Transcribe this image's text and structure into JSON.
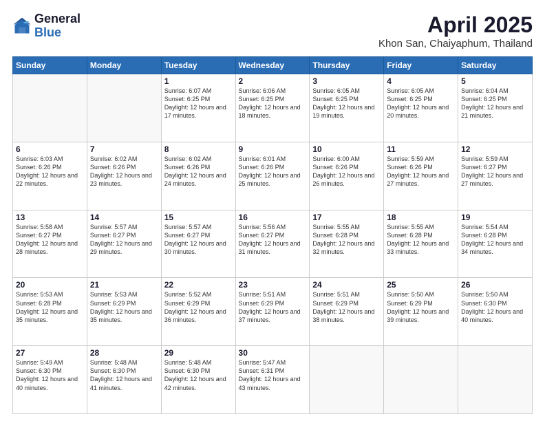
{
  "header": {
    "logo_general": "General",
    "logo_blue": "Blue",
    "title": "April 2025",
    "subtitle": "Khon San, Chaiyaphum, Thailand"
  },
  "weekdays": [
    "Sunday",
    "Monday",
    "Tuesday",
    "Wednesday",
    "Thursday",
    "Friday",
    "Saturday"
  ],
  "weeks": [
    [
      {
        "day": "",
        "info": ""
      },
      {
        "day": "",
        "info": ""
      },
      {
        "day": "1",
        "info": "Sunrise: 6:07 AM\nSunset: 6:25 PM\nDaylight: 12 hours and 17 minutes."
      },
      {
        "day": "2",
        "info": "Sunrise: 6:06 AM\nSunset: 6:25 PM\nDaylight: 12 hours and 18 minutes."
      },
      {
        "day": "3",
        "info": "Sunrise: 6:05 AM\nSunset: 6:25 PM\nDaylight: 12 hours and 19 minutes."
      },
      {
        "day": "4",
        "info": "Sunrise: 6:05 AM\nSunset: 6:25 PM\nDaylight: 12 hours and 20 minutes."
      },
      {
        "day": "5",
        "info": "Sunrise: 6:04 AM\nSunset: 6:25 PM\nDaylight: 12 hours and 21 minutes."
      }
    ],
    [
      {
        "day": "6",
        "info": "Sunrise: 6:03 AM\nSunset: 6:26 PM\nDaylight: 12 hours and 22 minutes."
      },
      {
        "day": "7",
        "info": "Sunrise: 6:02 AM\nSunset: 6:26 PM\nDaylight: 12 hours and 23 minutes."
      },
      {
        "day": "8",
        "info": "Sunrise: 6:02 AM\nSunset: 6:26 PM\nDaylight: 12 hours and 24 minutes."
      },
      {
        "day": "9",
        "info": "Sunrise: 6:01 AM\nSunset: 6:26 PM\nDaylight: 12 hours and 25 minutes."
      },
      {
        "day": "10",
        "info": "Sunrise: 6:00 AM\nSunset: 6:26 PM\nDaylight: 12 hours and 26 minutes."
      },
      {
        "day": "11",
        "info": "Sunrise: 5:59 AM\nSunset: 6:26 PM\nDaylight: 12 hours and 27 minutes."
      },
      {
        "day": "12",
        "info": "Sunrise: 5:59 AM\nSunset: 6:27 PM\nDaylight: 12 hours and 27 minutes."
      }
    ],
    [
      {
        "day": "13",
        "info": "Sunrise: 5:58 AM\nSunset: 6:27 PM\nDaylight: 12 hours and 28 minutes."
      },
      {
        "day": "14",
        "info": "Sunrise: 5:57 AM\nSunset: 6:27 PM\nDaylight: 12 hours and 29 minutes."
      },
      {
        "day": "15",
        "info": "Sunrise: 5:57 AM\nSunset: 6:27 PM\nDaylight: 12 hours and 30 minutes."
      },
      {
        "day": "16",
        "info": "Sunrise: 5:56 AM\nSunset: 6:27 PM\nDaylight: 12 hours and 31 minutes."
      },
      {
        "day": "17",
        "info": "Sunrise: 5:55 AM\nSunset: 6:28 PM\nDaylight: 12 hours and 32 minutes."
      },
      {
        "day": "18",
        "info": "Sunrise: 5:55 AM\nSunset: 6:28 PM\nDaylight: 12 hours and 33 minutes."
      },
      {
        "day": "19",
        "info": "Sunrise: 5:54 AM\nSunset: 6:28 PM\nDaylight: 12 hours and 34 minutes."
      }
    ],
    [
      {
        "day": "20",
        "info": "Sunrise: 5:53 AM\nSunset: 6:28 PM\nDaylight: 12 hours and 35 minutes."
      },
      {
        "day": "21",
        "info": "Sunrise: 5:53 AM\nSunset: 6:29 PM\nDaylight: 12 hours and 35 minutes."
      },
      {
        "day": "22",
        "info": "Sunrise: 5:52 AM\nSunset: 6:29 PM\nDaylight: 12 hours and 36 minutes."
      },
      {
        "day": "23",
        "info": "Sunrise: 5:51 AM\nSunset: 6:29 PM\nDaylight: 12 hours and 37 minutes."
      },
      {
        "day": "24",
        "info": "Sunrise: 5:51 AM\nSunset: 6:29 PM\nDaylight: 12 hours and 38 minutes."
      },
      {
        "day": "25",
        "info": "Sunrise: 5:50 AM\nSunset: 6:29 PM\nDaylight: 12 hours and 39 minutes."
      },
      {
        "day": "26",
        "info": "Sunrise: 5:50 AM\nSunset: 6:30 PM\nDaylight: 12 hours and 40 minutes."
      }
    ],
    [
      {
        "day": "27",
        "info": "Sunrise: 5:49 AM\nSunset: 6:30 PM\nDaylight: 12 hours and 40 minutes."
      },
      {
        "day": "28",
        "info": "Sunrise: 5:48 AM\nSunset: 6:30 PM\nDaylight: 12 hours and 41 minutes."
      },
      {
        "day": "29",
        "info": "Sunrise: 5:48 AM\nSunset: 6:30 PM\nDaylight: 12 hours and 42 minutes."
      },
      {
        "day": "30",
        "info": "Sunrise: 5:47 AM\nSunset: 6:31 PM\nDaylight: 12 hours and 43 minutes."
      },
      {
        "day": "",
        "info": ""
      },
      {
        "day": "",
        "info": ""
      },
      {
        "day": "",
        "info": ""
      }
    ]
  ],
  "colors": {
    "header_bg": "#2a6db5",
    "accent": "#1a1a2e"
  }
}
